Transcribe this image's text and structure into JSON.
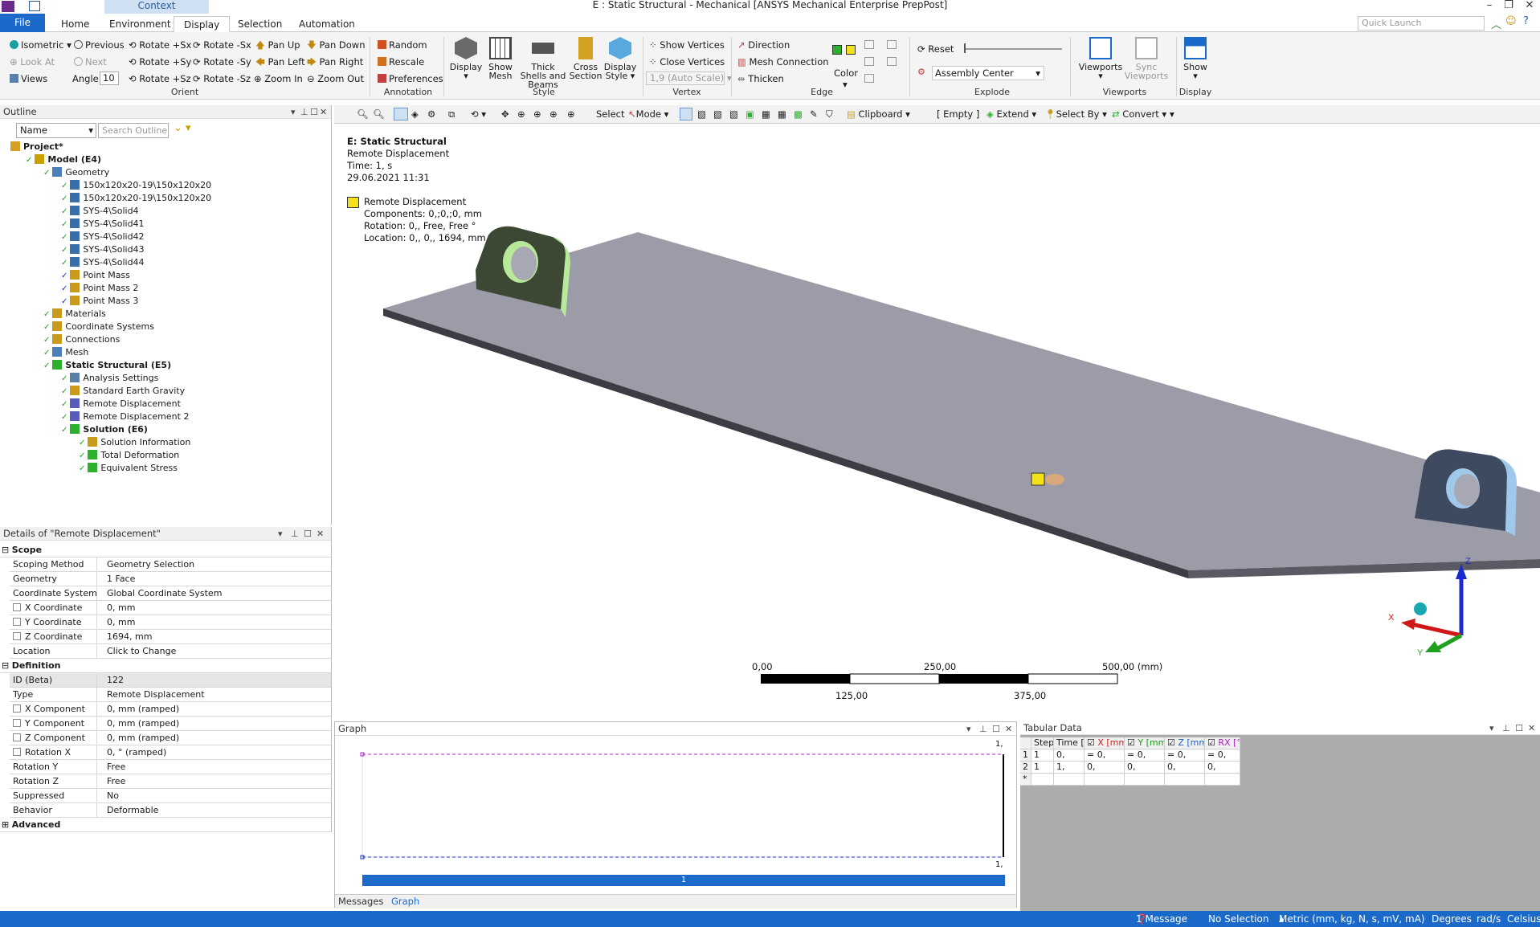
{
  "window": {
    "context_tab": "Context",
    "title": "E : Static Structural - Mechanical [ANSYS Mechanical Enterprise PrepPost]"
  },
  "tabs": [
    "File",
    "Home",
    "Environment",
    "Display",
    "Selection",
    "Automation"
  ],
  "active_tab": "Display",
  "quick_launch_placeholder": "Quick Launch",
  "ribbon": {
    "orient": {
      "isometric": "Isometric",
      "previous": "Previous",
      "rotate_px": "Rotate +Sx",
      "rotate_mx": "Rotate -Sx",
      "pan_up": "Pan Up",
      "pan_down": "Pan Down",
      "look_at": "Look At",
      "next": "Next",
      "rotate_py": "Rotate +Sy",
      "rotate_my": "Rotate -Sy",
      "pan_left": "Pan Left",
      "pan_right": "Pan Right",
      "views": "Views",
      "angle_label": "Angle",
      "angle_value": "10",
      "rotate_pz": "Rotate +Sz",
      "rotate_mz": "Rotate -Sz",
      "zoom_in": "Zoom In",
      "zoom_out": "Zoom Out",
      "group": "Orient"
    },
    "annotation": {
      "random": "Random",
      "rescale": "Rescale",
      "preferences": "Preferences",
      "group": "Annotation"
    },
    "style": {
      "display": "Display",
      "show_mesh": "Show Mesh",
      "thick_shells": "Thick Shells and Beams",
      "cross_section": "Cross Section",
      "display_style": "Display Style",
      "group": "Style"
    },
    "vertex": {
      "show_vertices": "Show Vertices",
      "close_vertices": "Close Vertices",
      "auto_scale": "1,9 (Auto Scale)",
      "group": "Vertex"
    },
    "edge": {
      "direction": "Direction",
      "mesh_connection": "Mesh Connection",
      "thicken": "Thicken",
      "color": "Color",
      "group": "Edge"
    },
    "explode": {
      "reset": "Reset",
      "assembly_center": "Assembly Center",
      "group": "Explode"
    },
    "viewports": {
      "viewports": "Viewports",
      "sync_viewports": "Sync Viewports",
      "group": "Viewports"
    },
    "display": {
      "show": "Show",
      "group": "Display"
    },
    "colors": {
      "accent": "#1b6ac9",
      "green": "#2db02d",
      "yellow": "#f2e018"
    }
  },
  "outline": {
    "header": "Outline",
    "filter_label": "Name",
    "search_placeholder": "Search Outline",
    "tree": [
      {
        "label": "Project*",
        "depth": 0,
        "bold": true
      },
      {
        "label": "Model (E4)",
        "depth": 1,
        "bold": true
      },
      {
        "label": "Geometry",
        "depth": 2
      },
      {
        "label": "150x120x20-19\\150x120x20",
        "depth": 3
      },
      {
        "label": "150x120x20-19\\150x120x20",
        "depth": 3
      },
      {
        "label": "SYS-4\\Solid4",
        "depth": 3
      },
      {
        "label": "SYS-4\\Solid41",
        "depth": 3
      },
      {
        "label": "SYS-4\\Solid42",
        "depth": 3
      },
      {
        "label": "SYS-4\\Solid43",
        "depth": 3
      },
      {
        "label": "SYS-4\\Solid44",
        "depth": 3
      },
      {
        "label": "Point Mass",
        "depth": 3
      },
      {
        "label": "Point Mass 2",
        "depth": 3
      },
      {
        "label": "Point Mass 3",
        "depth": 3
      },
      {
        "label": "Materials",
        "depth": 2
      },
      {
        "label": "Coordinate Systems",
        "depth": 2
      },
      {
        "label": "Connections",
        "depth": 2
      },
      {
        "label": "Mesh",
        "depth": 2
      },
      {
        "label": "Static Structural (E5)",
        "depth": 2,
        "bold": true
      },
      {
        "label": "Analysis Settings",
        "depth": 3
      },
      {
        "label": "Standard Earth Gravity",
        "depth": 3
      },
      {
        "label": "Remote Displacement",
        "depth": 3,
        "selected": true
      },
      {
        "label": "Remote Displacement 2",
        "depth": 3
      },
      {
        "label": "Solution (E6)",
        "depth": 3,
        "bold": true
      },
      {
        "label": "Solution Information",
        "depth": 4
      },
      {
        "label": "Total Deformation",
        "depth": 4
      },
      {
        "label": "Equivalent Stress",
        "depth": 4
      }
    ]
  },
  "details": {
    "header": "Details of \"Remote Displacement\"",
    "sections": [
      {
        "title": "Scope",
        "rows": [
          {
            "k": "Scoping Method",
            "v": "Geometry Selection"
          },
          {
            "k": "Geometry",
            "v": "1 Face"
          },
          {
            "k": "Coordinate System",
            "v": "Global Coordinate System"
          },
          {
            "k": "X Coordinate",
            "v": "0, mm",
            "cb": true
          },
          {
            "k": "Y Coordinate",
            "v": "0, mm",
            "cb": true
          },
          {
            "k": "Z Coordinate",
            "v": "1694, mm",
            "cb": true
          },
          {
            "k": "Location",
            "v": "Click to Change"
          }
        ]
      },
      {
        "title": "Definition",
        "rows": [
          {
            "k": "ID (Beta)",
            "v": "122",
            "grey": true
          },
          {
            "k": "Type",
            "v": "Remote Displacement"
          },
          {
            "k": "X Component",
            "v": "0, mm  (ramped)",
            "cb": true
          },
          {
            "k": "Y Component",
            "v": "0, mm  (ramped)",
            "cb": true
          },
          {
            "k": "Z Component",
            "v": "0, mm  (ramped)",
            "cb": true
          },
          {
            "k": "Rotation X",
            "v": "0, °  (ramped)",
            "cb": true
          },
          {
            "k": "Rotation Y",
            "v": "Free"
          },
          {
            "k": "Rotation Z",
            "v": "Free"
          },
          {
            "k": "Suppressed",
            "v": "No"
          },
          {
            "k": "Behavior",
            "v": "Deformable"
          }
        ]
      },
      {
        "title": "Advanced",
        "rows": []
      }
    ]
  },
  "graphics_toolbar": {
    "select": "Select",
    "mode": "Mode",
    "clipboard": "Clipboard",
    "empty": "[ Empty ]",
    "extend": "Extend",
    "select_by": "Select By",
    "convert": "Convert"
  },
  "viewport": {
    "title": "E: Static Structural",
    "subtitle": "Remote Displacement",
    "time": "Time: 1, s",
    "date": "29.06.2021 11:31",
    "legend_label": "Remote Displacement",
    "legend_components": "Components: 0,;0,;0, mm",
    "legend_rotation": "Rotation: 0,, Free, Free °",
    "legend_location": "Location: 0,, 0,, 1694, mm",
    "scale_top": [
      "0,00",
      "250,00",
      "500,00 (mm)"
    ],
    "scale_bottom": [
      "125,00",
      "375,00"
    ],
    "axes": {
      "x": "X",
      "y": "Y",
      "z": "Z"
    }
  },
  "graph": {
    "header": "Graph",
    "y_label_top": "1,",
    "x_label": "1,",
    "bar_label": "1",
    "tabs": [
      "Messages",
      "Graph"
    ],
    "active_tab": "Graph"
  },
  "tabular": {
    "header": "Tabular Data",
    "columns": [
      "Steps",
      "Time [s]",
      "X [mm]",
      "Y [mm]",
      "Z [mm]",
      "RX [°]"
    ],
    "column_colors": [
      "#1a1a1a",
      "#1a1a1a",
      "#d42020",
      "#1e9a1e",
      "#1b5ec9",
      "#b020c8"
    ],
    "rows": [
      [
        "1",
        "1",
        "0,",
        "= 0,",
        "= 0,",
        "= 0,",
        "= 0,"
      ],
      [
        "2",
        "1",
        "1,",
        "0,",
        "0,",
        "0,",
        "0,"
      ],
      [
        "*",
        "",
        "",
        "",
        "",
        "",
        ""
      ]
    ]
  },
  "status": {
    "messages": "1 Message",
    "selection": "No Selection",
    "units": "Metric (mm, kg, N, s, mV, mA)",
    "degrees": "Degrees",
    "rads": "rad/s",
    "celsius": "Celsius"
  }
}
